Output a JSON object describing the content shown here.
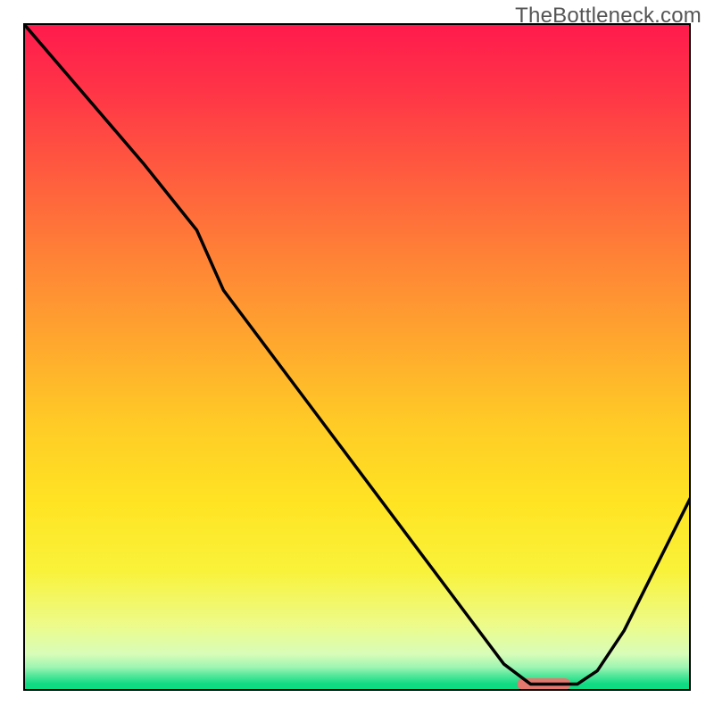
{
  "watermark": "TheBottleneck.com",
  "chart_data": {
    "type": "line",
    "title": "",
    "xlabel": "",
    "ylabel": "",
    "xlim": [
      0,
      100
    ],
    "ylim": [
      0,
      100
    ],
    "series": [
      {
        "name": "bottleneck-curve",
        "x": [
          0,
          6,
          12,
          18,
          22,
          26,
          30,
          36,
          42,
          48,
          54,
          60,
          66,
          72,
          76,
          80,
          83,
          86,
          90,
          94,
          98,
          100
        ],
        "y": [
          100,
          93,
          86,
          79,
          74,
          69,
          60,
          52,
          44,
          36,
          28,
          20,
          12,
          4,
          1,
          1,
          1,
          3,
          9,
          17,
          25,
          29
        ],
        "color": "#000000"
      }
    ],
    "marker": {
      "name": "optimal-range",
      "x_start": 74,
      "x_end": 82,
      "y": 1,
      "color": "#e4776e"
    },
    "gradient_stops": [
      {
        "offset": 0.0,
        "color": "#ff1a4d"
      },
      {
        "offset": 0.1,
        "color": "#ff3447"
      },
      {
        "offset": 0.22,
        "color": "#ff5a3f"
      },
      {
        "offset": 0.35,
        "color": "#ff8236"
      },
      {
        "offset": 0.48,
        "color": "#ffa82e"
      },
      {
        "offset": 0.6,
        "color": "#ffcb26"
      },
      {
        "offset": 0.72,
        "color": "#ffe423"
      },
      {
        "offset": 0.82,
        "color": "#f9f23a"
      },
      {
        "offset": 0.9,
        "color": "#edfb88"
      },
      {
        "offset": 0.945,
        "color": "#d8fdb8"
      },
      {
        "offset": 0.965,
        "color": "#9cf5b2"
      },
      {
        "offset": 0.978,
        "color": "#4ee698"
      },
      {
        "offset": 0.99,
        "color": "#0fdb82"
      },
      {
        "offset": 1.0,
        "color": "#0fdb82"
      }
    ],
    "frame_color": "#000000",
    "frame_width": 4
  }
}
